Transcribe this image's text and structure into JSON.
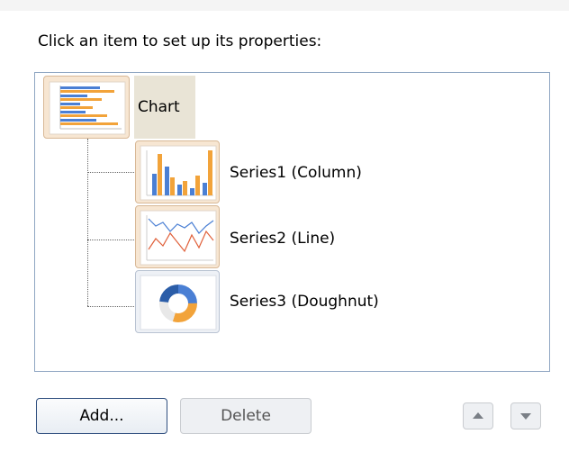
{
  "instructions": "Click an item to set up its properties:",
  "tree": {
    "root": {
      "label": "Chart",
      "icon": "bar-chart-icon",
      "selected": true
    },
    "children": [
      {
        "label": "Series1 (Column)",
        "icon": "column-chart-icon"
      },
      {
        "label": "Series2 (Line)",
        "icon": "line-chart-icon"
      },
      {
        "label": "Series3 (Doughnut)",
        "icon": "doughnut-chart-icon"
      }
    ]
  },
  "buttons": {
    "add": "Add...",
    "delete": "Delete",
    "move_up_icon": "up-arrow-icon",
    "move_down_icon": "down-arrow-icon"
  },
  "colors": {
    "panel_border": "#8fa6c2",
    "selection_bg": "#e9e4d6",
    "series_blue": "#4a7fd4",
    "series_orange": "#f2a33a"
  }
}
